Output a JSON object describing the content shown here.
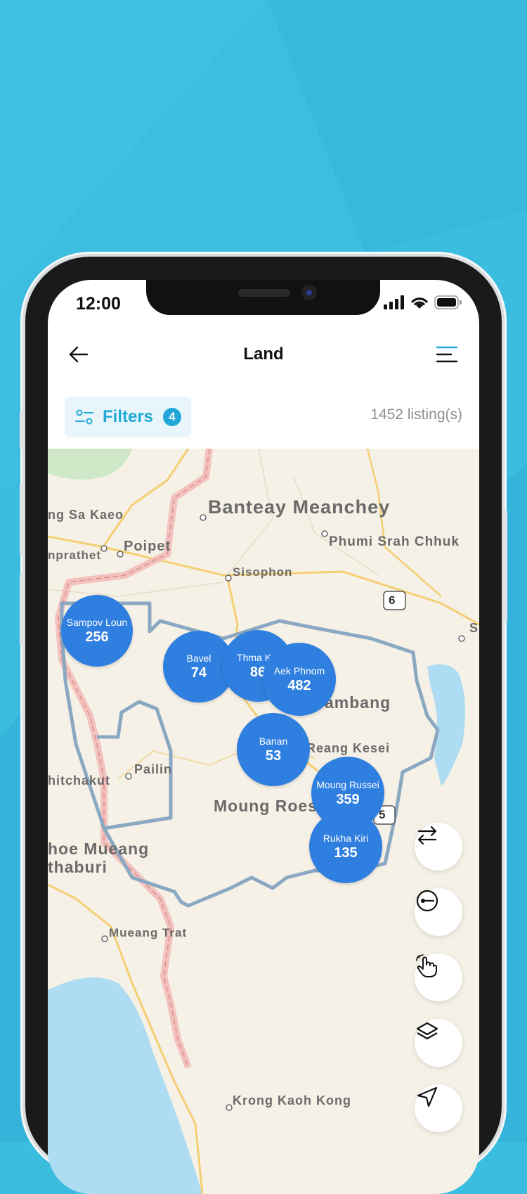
{
  "status_bar": {
    "time": "12:00"
  },
  "header": {
    "title": "Land",
    "back_icon": "arrow-left-icon",
    "menu_icon": "menu-icon"
  },
  "filters": {
    "label": "Filters",
    "count": "4",
    "icon": "sliders-icon",
    "listings": "1452 listing(s)"
  },
  "map": {
    "labels": {
      "banteay": "Banteay Meanchey",
      "sakaeo": "ng Sa Kaeo",
      "poipet": "Poipet",
      "srah": "Phumi Srah Chhuk",
      "prathet": "nprathet",
      "sisophon": "Sisophon",
      "road6": "6",
      "s_edge": "S",
      "ambang": "ambang",
      "reang": "Reang Kesei",
      "pailin": "Pailin",
      "hitchakut": "hitchakut",
      "moung": "Moung Roes",
      "road5": "5",
      "hoe1": "hoe Mueang",
      "hoe2": "thaburi",
      "trat": "Mueang Trat",
      "kong": "Krong Kaoh Kong"
    },
    "clusters": [
      {
        "name": "Sampov Loun",
        "count": "256"
      },
      {
        "name": "Bavel",
        "count": "74"
      },
      {
        "name": "Thma Kol",
        "count": "86"
      },
      {
        "name": "Aek Phnom",
        "count": "482"
      },
      {
        "name": "Banan",
        "count": "53"
      },
      {
        "name": "Moung Russei",
        "count": "359"
      },
      {
        "name": "Rukha Kiri",
        "count": "135"
      }
    ],
    "controls": [
      "swap-icon",
      "route-icon",
      "hand-pointer-icon",
      "layers-icon",
      "navigation-icon"
    ]
  }
}
